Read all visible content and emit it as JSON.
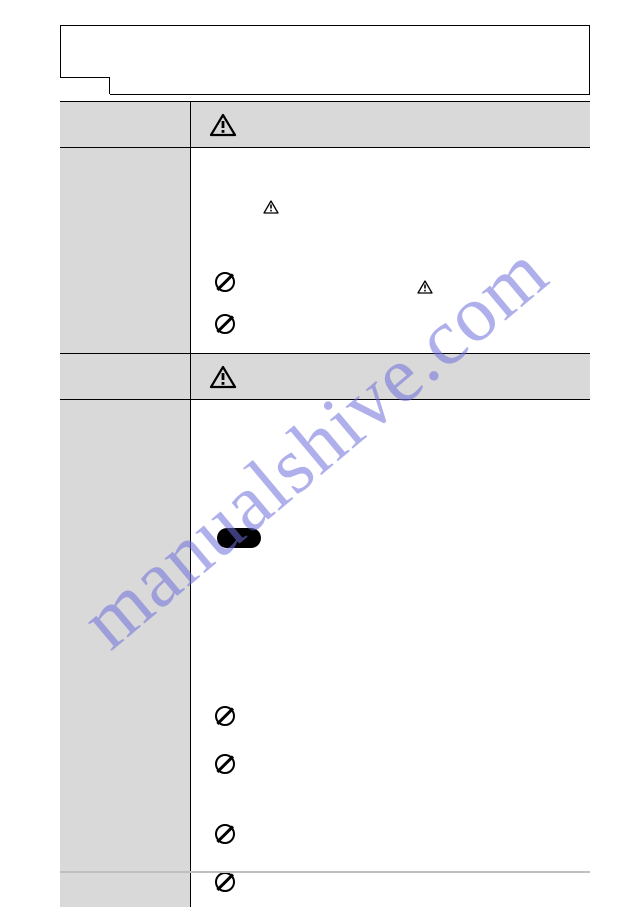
{
  "watermark": "manualshive.com",
  "section1": {
    "heading": "",
    "warnings": []
  },
  "section2": {
    "heading": "",
    "warnings": []
  }
}
